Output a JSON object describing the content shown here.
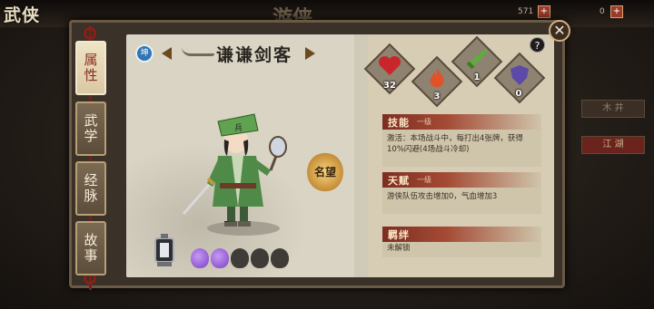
{
  "background": {
    "logo": "武侠",
    "bg_title": "游侠",
    "top_res_1": "571",
    "top_res_2": "0",
    "right_btn_1": "木 井",
    "right_btn_2": "江 湖"
  },
  "tabs": [
    {
      "label": "属性",
      "active": true
    },
    {
      "label": "武学",
      "active": false
    },
    {
      "label": "经脉",
      "active": false
    },
    {
      "label": "故事",
      "active": false
    }
  ],
  "hero": {
    "faction_badge": "坤",
    "name": "谦谦剑客",
    "fame_label": "名望"
  },
  "stars": {
    "filled": 2,
    "total": 5
  },
  "stats": [
    {
      "icon": "heart-icon",
      "value": "32",
      "color": "#c8262b"
    },
    {
      "icon": "flame-icon",
      "value": "3",
      "color": "#e0532a"
    },
    {
      "icon": "sword-icon",
      "value": "1",
      "color": "#5cae3b"
    },
    {
      "icon": "shield-icon",
      "value": "0",
      "color": "#5d49a8"
    }
  ],
  "skill": {
    "title": "技能",
    "level": "一级",
    "text": "激活：本场战斗中，每打出4张牌，获得10%闪避(4场战斗冷却)"
  },
  "talent": {
    "title": "天赋",
    "level": "一级",
    "text": "游侠队伍攻击增加0，气血增加3"
  },
  "bond": {
    "title": "羁绊",
    "text": "未解锁"
  },
  "buttons": {
    "help": "?",
    "close": "✕"
  }
}
